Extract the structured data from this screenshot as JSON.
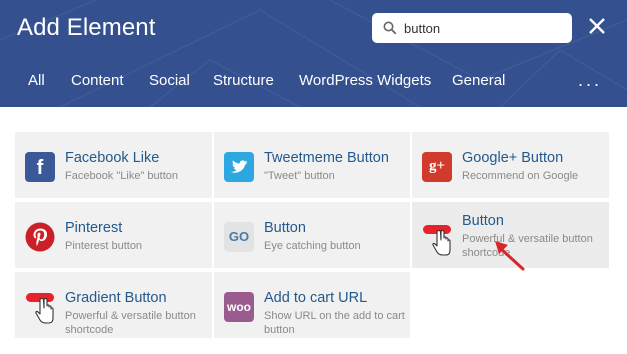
{
  "header": {
    "title": "Add Element",
    "search_value": "button",
    "tabs": [
      "All",
      "Content",
      "Social",
      "Structure",
      "WordPress Widgets",
      "General"
    ],
    "more_label": "..."
  },
  "elements": [
    {
      "name": "Facebook Like",
      "desc": "Facebook \"Like\" button",
      "icon": "facebook-icon"
    },
    {
      "name": "Tweetmeme Button",
      "desc": "\"Tweet\" button",
      "icon": "twitter-icon"
    },
    {
      "name": "Google+ Button",
      "desc": "Recommend on Google",
      "icon": "google-plus-icon",
      "glyph": "g+"
    },
    {
      "name": "Pinterest",
      "desc": "Pinterest button",
      "icon": "pinterest-icon"
    },
    {
      "name": "Button",
      "desc": "Eye catching button",
      "icon": "go-button-icon",
      "glyph": "GO"
    },
    {
      "name": "Button",
      "desc": "Powerful & versatile button shortcode",
      "icon": "button-cursor-icon"
    },
    {
      "name": "Gradient Button",
      "desc": "Powerful & versatile button shortcode",
      "icon": "button-cursor-icon"
    },
    {
      "name": "Add to cart URL",
      "desc": "Show URL on the add to cart button",
      "icon": "woo-icon",
      "glyph": "woo"
    }
  ],
  "colors": {
    "header_bg": "#34508f",
    "card_bg": "#f1f1f1",
    "element_title": "#24598c",
    "pointer_arrow": "#d9262a"
  }
}
